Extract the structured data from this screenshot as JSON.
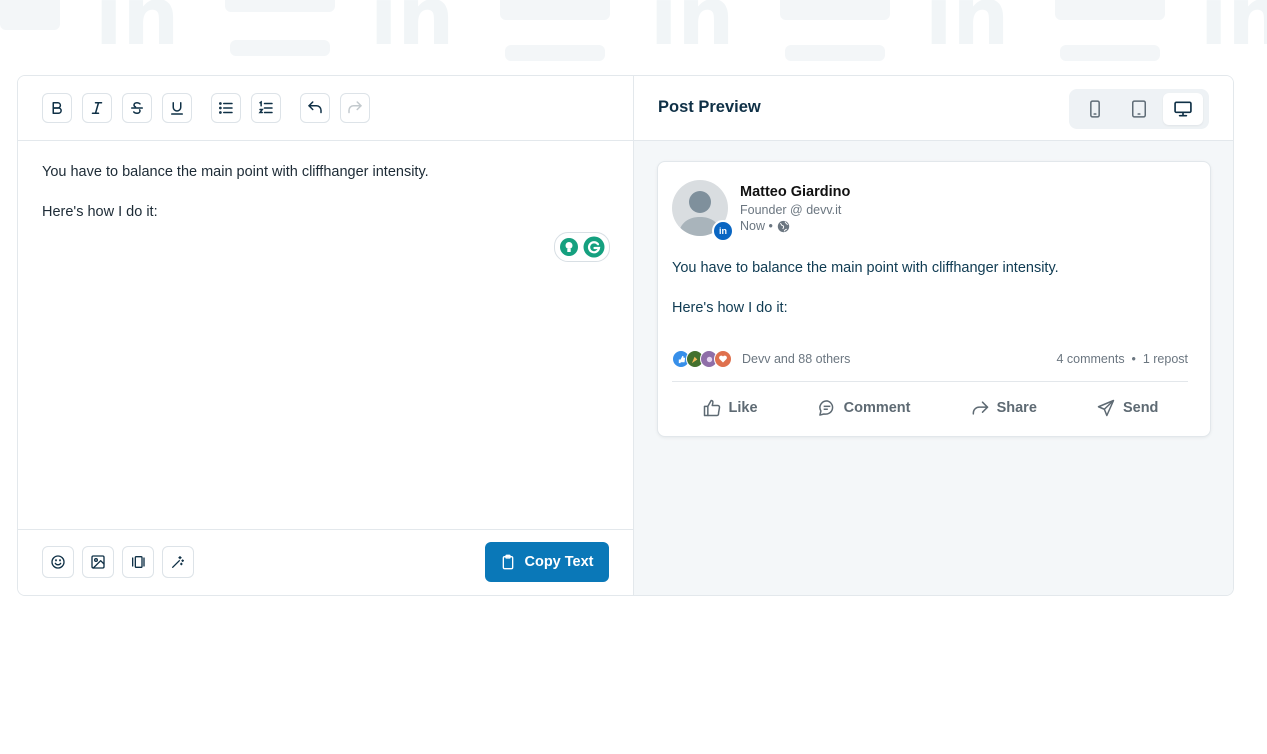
{
  "toolbar": {
    "bold": "B",
    "italic": "I",
    "strike": "S",
    "underline": "U"
  },
  "editor": {
    "paragraphs": [
      "You have to balance the main point with cliffhanger intensity.",
      "Here's how I do it:"
    ]
  },
  "footer": {
    "copy_label": "Copy Text"
  },
  "preview": {
    "title": "Post Preview",
    "devices": [
      "mobile-icon",
      "tablet-icon",
      "desktop-icon"
    ],
    "active_device": "desktop"
  },
  "post": {
    "author": "Matteo Giardino",
    "role": "Founder @ devv.it",
    "time": "Now •",
    "badge": "in",
    "body": [
      "You have to balance the main point with cliffhanger intensity.",
      "Here's how I do it:"
    ],
    "reactions_text": "Devv and 88 others",
    "stats": "4 comments  •  1 repost",
    "actions": {
      "like": "Like",
      "comment": "Comment",
      "share": "Share",
      "send": "Send"
    }
  },
  "colors": {
    "accent": "#0a78b8",
    "linkedin": "#0a66c2",
    "text": "#0f3b52"
  }
}
